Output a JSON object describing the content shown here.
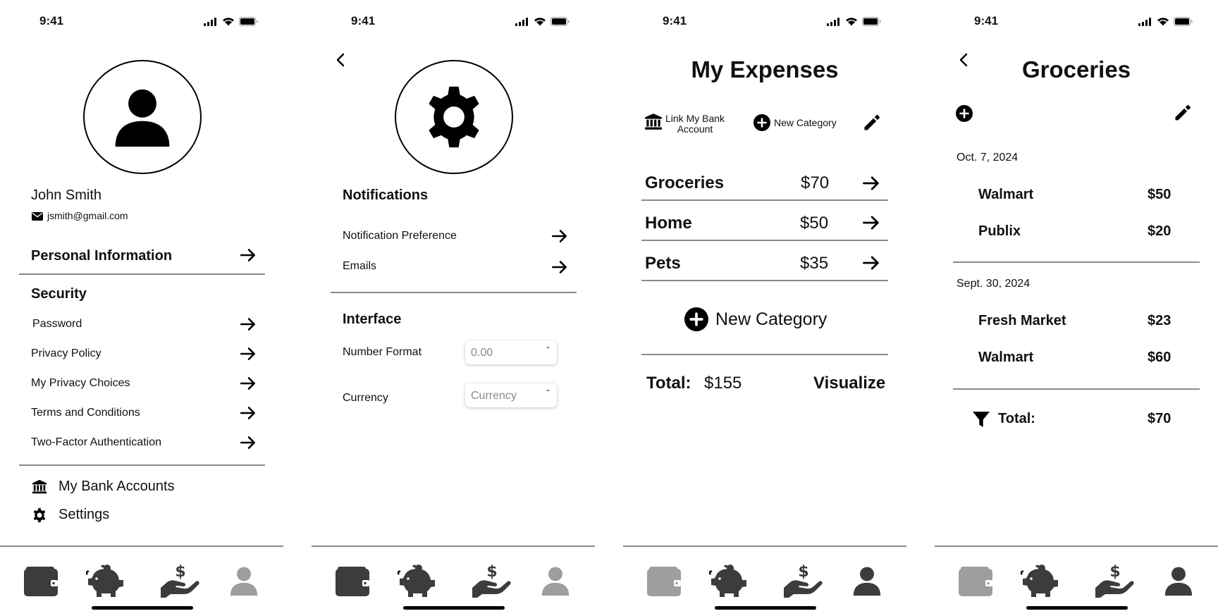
{
  "status": {
    "time": "9:41"
  },
  "profile": {
    "name": "John Smith",
    "email": "jsmith@gmail.com",
    "personal_info": "Personal Information",
    "security_heading": "Security",
    "security_items": [
      {
        "label": "Password"
      },
      {
        "label": "Privacy Policy"
      },
      {
        "label": "My Privacy Choices"
      },
      {
        "label": "Terms and Conditions"
      },
      {
        "label": "Two-Factor Authentication"
      }
    ],
    "bank_accounts": "My Bank Accounts",
    "settings": "Settings"
  },
  "settings_screen": {
    "notifications_heading": "Notifications",
    "notification_pref": "Notification Preference",
    "emails": "Emails",
    "interface_heading": "Interface",
    "number_format_label": "Number Format",
    "number_format_value": "0.00",
    "currency_label": "Currency",
    "currency_value": "Currency"
  },
  "expenses": {
    "title": "My Expenses",
    "link_bank_line1": "Link My Bank",
    "link_bank_line2": "Account",
    "new_category_small": "New Category",
    "categories": [
      {
        "name": "Groceries",
        "amount": "$70"
      },
      {
        "name": "Home",
        "amount": "$50"
      },
      {
        "name": "Pets",
        "amount": "$35"
      }
    ],
    "new_category": "New Category",
    "total_label": "Total:",
    "total_value": "$155",
    "visualize": "Visualize"
  },
  "groceries": {
    "title": "Groceries",
    "groups": [
      {
        "date": "Oct. 7, 2024",
        "items": [
          {
            "store": "Walmart",
            "amount": "$50"
          },
          {
            "store": "Publix",
            "amount": "$20"
          }
        ]
      },
      {
        "date": "Sept. 30, 2024",
        "items": [
          {
            "store": "Fresh Market",
            "amount": "$23"
          },
          {
            "store": "Walmart",
            "amount": "$60"
          }
        ]
      }
    ],
    "total_label": "Total:",
    "total_value": "$70"
  },
  "nav": {
    "icons": [
      "wallet-icon",
      "piggy-bank-icon",
      "hand-dollar-icon",
      "user-icon"
    ],
    "active_color": "#3c3c3c",
    "inactive_color": "#9e9e9e"
  }
}
